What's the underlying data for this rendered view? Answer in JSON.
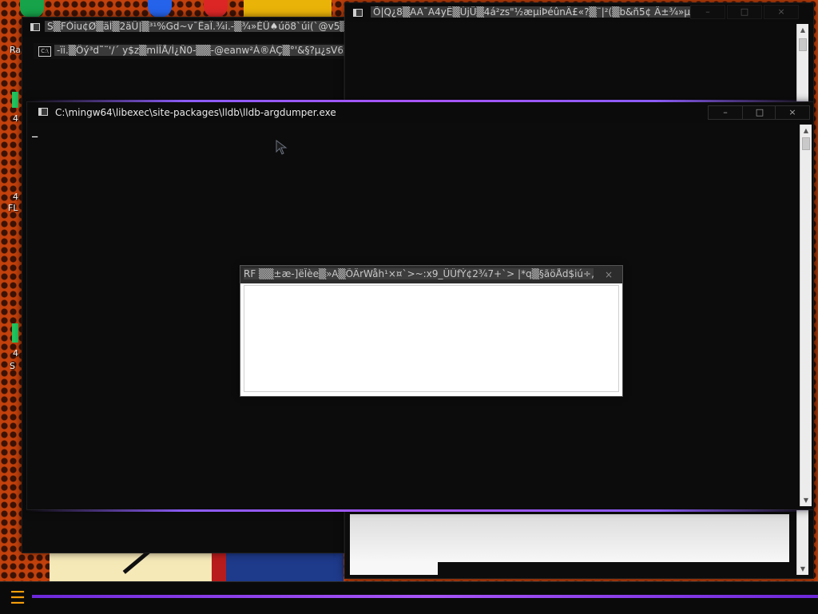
{
  "desktop": {
    "labels": [
      "Ra",
      "4",
      "4",
      "FL",
      "4",
      "S"
    ]
  },
  "windows": {
    "top_left": {
      "title": "S▒FÒiu¢Ø▒äÌ▒2äÜ|▒³¹%Gd~v¯ËaÏ.¾i.-▒¾»ÉÜ♠úö8`úi(`@v5▒µÄ",
      "controls": [
        "–",
        "□",
        "×"
      ]
    },
    "top_left_child": {
      "title": "-ïi.▒Öý³d˜¨'/´ y$z▒mÌÎÅ/Ì¿Ñ0-▒▒-@eanw²À®ÀÇ▒°'&§?µ¿sV6S-"
    },
    "top_right": {
      "title": "Õ|Q¿8▒AA¯A4yÊ▒ÚjÜ▒4á²zs\"½æµiÞéûnÄ£«?▒¨|²(▒b&ñ5¢ Ä±¾»µ¦▒û...",
      "controls": [
        "–",
        "□",
        "×"
      ]
    },
    "main": {
      "title": "C:\\mingw64\\libexec\\site-packages\\lldb\\lldb-argdumper.exe",
      "cursor": "_",
      "controls": [
        "–",
        "□",
        "×"
      ]
    },
    "dialog": {
      "title": "RF ▒▒±æ-]ëÎèe▒»A▒ÕÄrWåh¹×¤`>~:x9_ÜÛfÝ¢2¾7+`> |*q▒§ãöÅd$iú÷,®«▒...",
      "close_label": "×"
    }
  },
  "taskbar": {
    "start_label": "☰"
  }
}
